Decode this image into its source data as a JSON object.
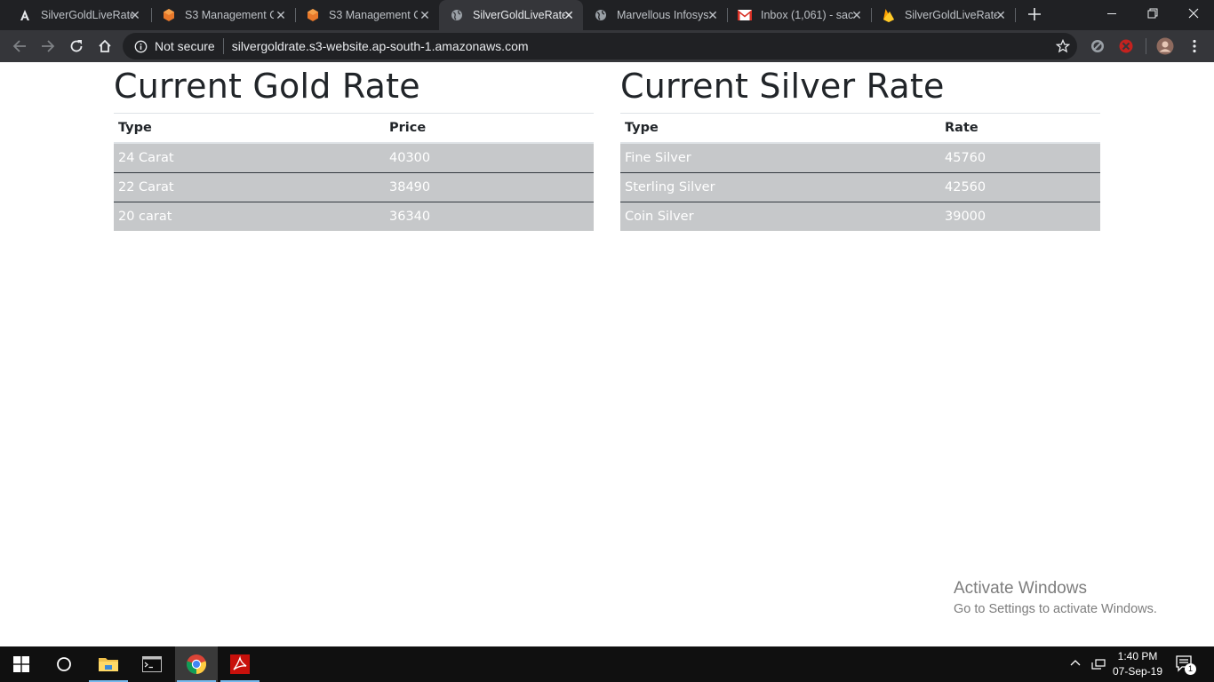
{
  "browser": {
    "tabs": [
      {
        "title": "SilverGoldLiveRate",
        "icon": "angular-icon",
        "active": false
      },
      {
        "title": "S3 Management C",
        "icon": "aws-s3-icon",
        "active": false
      },
      {
        "title": "S3 Management C",
        "icon": "aws-s3-icon",
        "active": false
      },
      {
        "title": "SilverGoldLiveRate",
        "icon": "globe-icon",
        "active": true
      },
      {
        "title": "Marvellous Infosys",
        "icon": "globe-icon",
        "active": false
      },
      {
        "title": "Inbox (1,061) - sac",
        "icon": "gmail-icon",
        "active": false
      },
      {
        "title": "SilverGoldLiveRate",
        "icon": "firebase-icon",
        "active": false
      }
    ],
    "omnibox": {
      "security_label": "Not secure",
      "url": "silvergoldrate.s3-website.ap-south-1.amazonaws.com"
    }
  },
  "page": {
    "gold": {
      "heading": "Current Gold Rate",
      "columns": [
        "Type",
        "Price"
      ],
      "rows": [
        {
          "type": "24 Carat",
          "value": "40300"
        },
        {
          "type": "22 Carat",
          "value": "38490"
        },
        {
          "type": "20 carat",
          "value": "36340"
        }
      ]
    },
    "silver": {
      "heading": "Current Silver Rate",
      "columns": [
        "Type",
        "Rate"
      ],
      "rows": [
        {
          "type": "Fine Silver",
          "value": "45760"
        },
        {
          "type": "Sterling Silver",
          "value": "42560"
        },
        {
          "type": "Coin Silver",
          "value": "39000"
        }
      ]
    }
  },
  "watermark": {
    "line1": "Activate Windows",
    "line2": "Go to Settings to activate Windows."
  },
  "taskbar": {
    "time": "1:40 PM",
    "date": "07-Sep-19",
    "notification_count": "1"
  },
  "colors": {
    "table_row_bg": "#c6c8ca",
    "row_text": "#ffffff",
    "heading_text": "#212529"
  }
}
